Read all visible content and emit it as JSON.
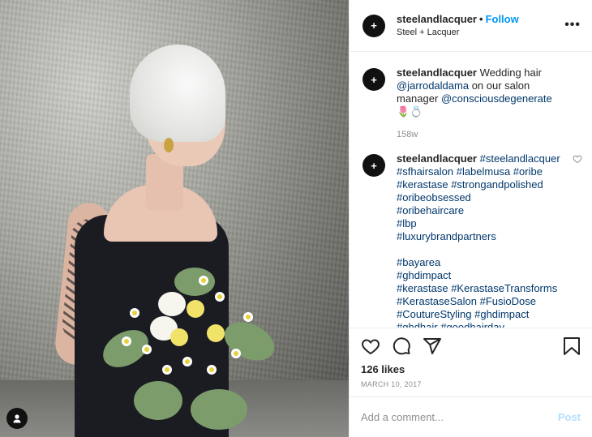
{
  "header": {
    "username": "steelandlacquer",
    "dot": "•",
    "follow_label": "Follow",
    "subtitle": "Steel + Lacquer",
    "more_label": "•••"
  },
  "caption": {
    "username": "steelandlacquer",
    "text_1": "Wedding hair",
    "mention_1": "@jarrodaldama",
    "text_2": "on our salon manager",
    "mention_2": "@consciousdegenerate",
    "emoji": "🌷💍",
    "age": "158w"
  },
  "comment": {
    "username": "steelandlacquer",
    "hashtags_block_1": [
      "#steelandlacquer",
      "#sfhairsalon #labelmusa #oribe",
      "#kerastase #strongandpolished",
      "#oribeobsessed",
      "#oribehaircare",
      "#lbp",
      "#luxurybrandpartners"
    ],
    "hashtags_block_2": [
      "#bayarea",
      "#ghdimpact",
      "#kerastase #KerastaseTransforms",
      "#KerastaseSalon #FusioDose",
      "#CoutureStyling #ghdimpact",
      "#ghdhair #goodhairday"
    ]
  },
  "actions": {
    "likes": "126 likes",
    "date": "MARCH 10, 2017"
  },
  "add_comment": {
    "placeholder": "Add a comment...",
    "post_label": "Post"
  },
  "icons": {
    "like": "heart-icon",
    "comment": "comment-icon",
    "share": "share-icon",
    "save": "bookmark-icon",
    "user_tag": "user-tag-icon"
  },
  "colors": {
    "accent": "#0095f6",
    "link": "#00376b",
    "muted": "#8e8e8e",
    "post_disabled": "#b2dffc"
  }
}
